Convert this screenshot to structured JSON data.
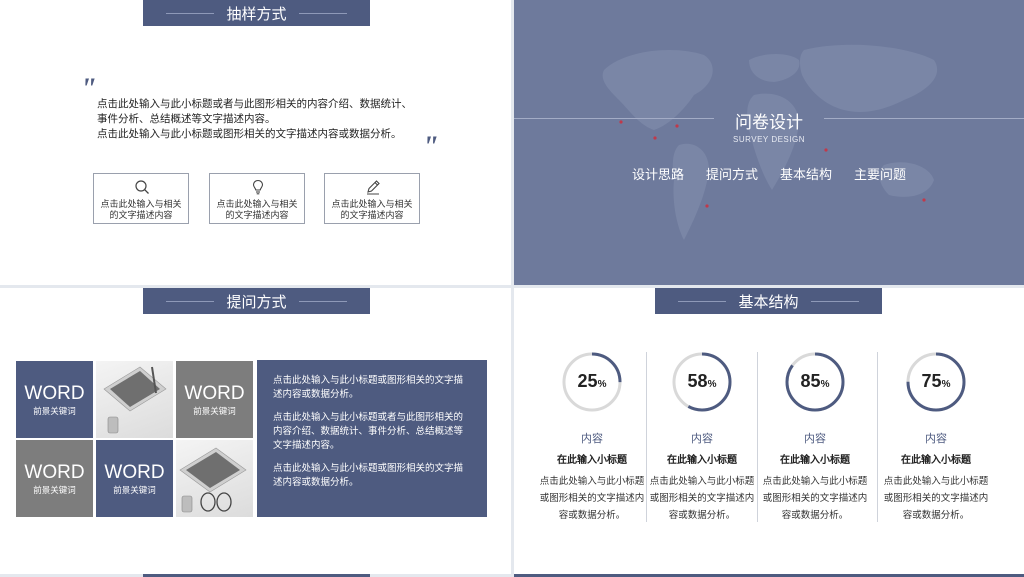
{
  "slide_a": {
    "title": "抽样方式",
    "paragraph_line1": "点击此处输入与此小标题或者与此图形相关的内容介绍、数据统计、",
    "paragraph_line2": "事件分析、总结概述等文字描述内容。",
    "paragraph_line3": "点击此处输入与此小标题或图形相关的文字描述内容或数据分析。",
    "boxes": [
      {
        "icon": "search-icon",
        "line1": "点击此处输入与相关",
        "line2": "的文字描述内容"
      },
      {
        "icon": "lightbulb-icon",
        "line1": "点击此处输入与相关",
        "line2": "的文字描述内容"
      },
      {
        "icon": "pen-icon",
        "line1": "点击此处输入与相关",
        "line2": "的文字描述内容"
      }
    ]
  },
  "slide_b": {
    "title": "问卷设计",
    "subtitle": "SURVEY DESIGN",
    "nav": [
      "设计思路",
      "提问方式",
      "基本结构",
      "主要问题"
    ]
  },
  "slide_c": {
    "title": "提问方式",
    "tiles": [
      {
        "word": "WORD",
        "keyword": "前景关键词"
      },
      {
        "word": "WORD",
        "keyword": "前景关键词"
      },
      {
        "word": "WORD",
        "keyword": "前景关键词"
      },
      {
        "word": "WORD",
        "keyword": "前景关键词"
      }
    ],
    "text": [
      "点击此处输入与此小标题或图形相关的文字描述内容或数据分析。",
      "点击此处输入与此小标题或者与此图形相关的内容介绍、数据统计、事件分析、总结概述等文字描述内容。",
      "点击此处输入与此小标题或图形相关的文字描述内容或数据分析。"
    ]
  },
  "slide_d": {
    "title": "基本结构",
    "percent_sign": "%",
    "items": [
      {
        "value": 25,
        "label": "内容",
        "subtitle": "在此输入小标题",
        "desc": "点击此处输入与此小标题或图形相关的文字描述内容或数据分析。"
      },
      {
        "value": 58,
        "label": "内容",
        "subtitle": "在此输入小标题",
        "desc": "点击此处输入与此小标题或图形相关的文字描述内容或数据分析。"
      },
      {
        "value": 85,
        "label": "内容",
        "subtitle": "在此输入小标题",
        "desc": "点击此处输入与此小标题或图形相关的文字描述内容或数据分析。"
      },
      {
        "value": 75,
        "label": "内容",
        "subtitle": "在此输入小标题",
        "desc": "点击此处输入与此小标题或图形相关的文字描述内容或数据分析。"
      }
    ]
  },
  "colors": {
    "accent": "#4e5b80",
    "map_bg": "#6e7a9c",
    "tile_grey": "#7d7d7d",
    "map_dot": "#c0394b"
  }
}
